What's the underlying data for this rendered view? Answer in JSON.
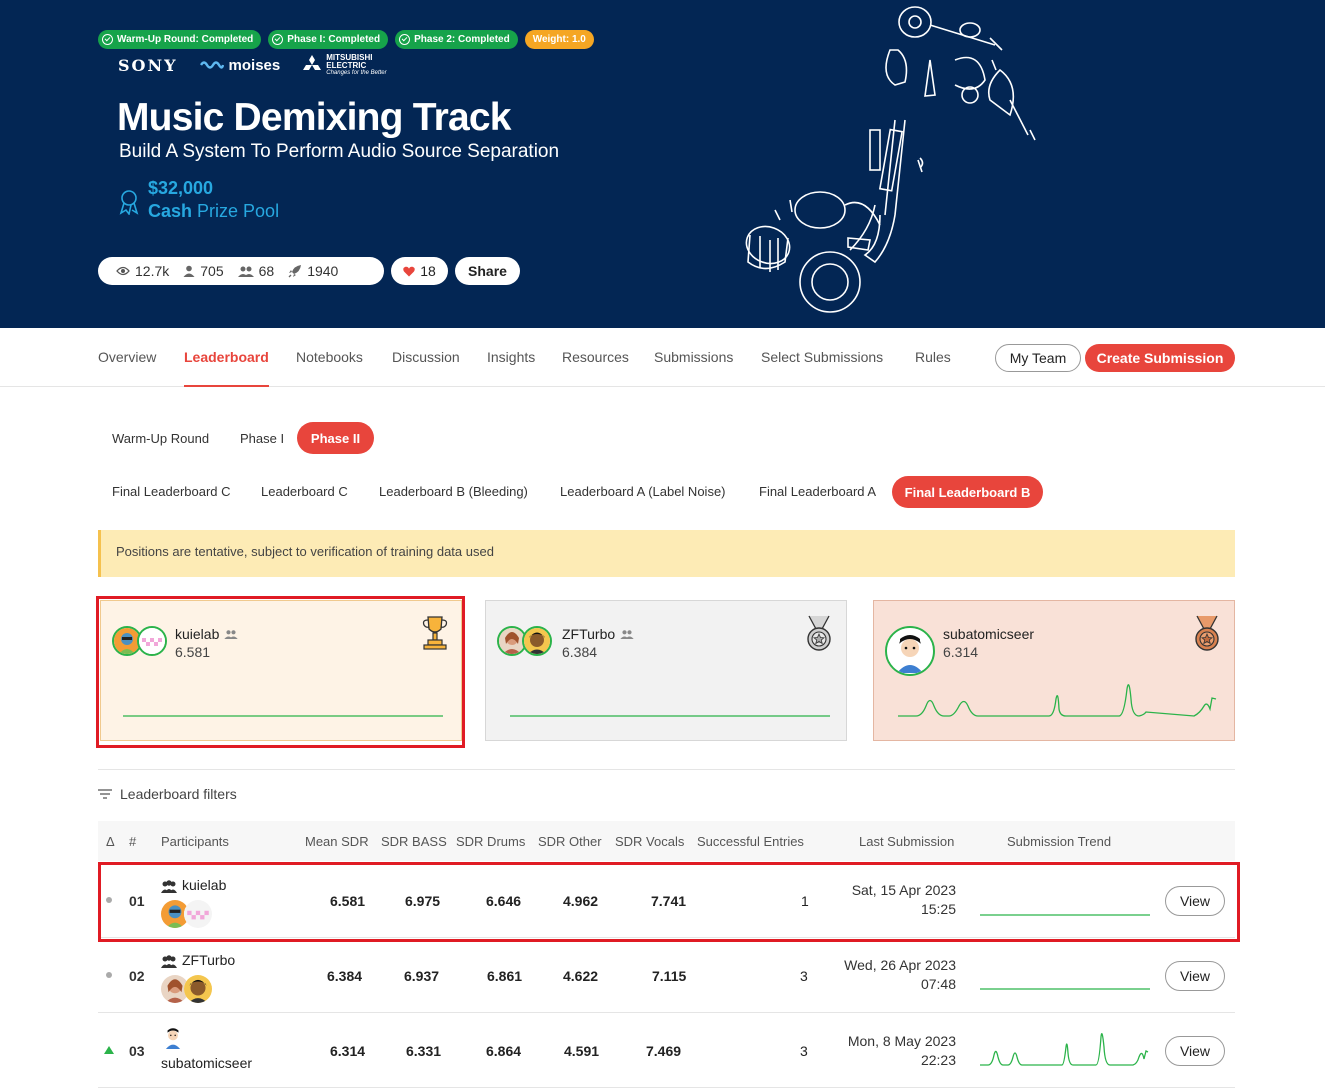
{
  "hero": {
    "badges": [
      {
        "label": "Warm-Up Round: Completed",
        "color": "#16a34a"
      },
      {
        "label": "Phase I: Completed",
        "color": "#16a34a"
      },
      {
        "label": "Phase 2: Completed",
        "color": "#16a34a"
      },
      {
        "label": "Weight: 1.0",
        "color": "#f5a623"
      }
    ],
    "sponsors": {
      "sony": "SONY",
      "moises": "moises",
      "mitsubishi_line1": "MITSUBISHI",
      "mitsubishi_line2": "ELECTRIC",
      "mitsubishi_tagline": "Changes for the Better"
    },
    "title": "Music Demixing Track",
    "subtitle": "Build A System To Perform Audio Source Separation",
    "prize_amount": "$32,000",
    "prize_label_bold": "Cash",
    "prize_label_rest": "Prize Pool",
    "stats": {
      "views": "12.7k",
      "participants": "705",
      "teams": "68",
      "submissions": "1940"
    },
    "likes": "18",
    "share_label": "Share"
  },
  "nav": {
    "items": [
      "Overview",
      "Leaderboard",
      "Notebooks",
      "Discussion",
      "Insights",
      "Resources",
      "Submissions",
      "Select Submissions",
      "Rules"
    ],
    "active": "Leaderboard",
    "my_team": "My Team",
    "create_submission": "Create Submission"
  },
  "rounds": [
    "Warm-Up Round",
    "Phase I",
    "Phase II"
  ],
  "active_round": "Phase II",
  "boards": [
    "Final Leaderboard C",
    "Leaderboard C",
    "Leaderboard B (Bleeding)",
    "Leaderboard A (Label Noise)",
    "Final Leaderboard A",
    "Final Leaderboard B"
  ],
  "active_board": "Final Leaderboard B",
  "notice": "Positions are tentative, subject to verification of training data used",
  "podium": [
    {
      "name": "kuielab",
      "score": "6.581",
      "medal": "trophy-icon"
    },
    {
      "name": "ZFTurbo",
      "score": "6.384",
      "medal": "silver-medal-icon"
    },
    {
      "name": "subatomicseer",
      "score": "6.314",
      "medal": "bronze-medal-icon"
    }
  ],
  "filters_label": "Leaderboard filters",
  "table": {
    "headers": [
      "Δ",
      "#",
      "Participants",
      "Mean SDR",
      "SDR BASS",
      "SDR Drums",
      "SDR Other",
      "SDR Vocals",
      "Successful Entries",
      "Last Submission",
      "Submission Trend"
    ],
    "rows": [
      {
        "delta": "dot",
        "rank": "01",
        "name": "kuielab",
        "mean": "6.581",
        "bass": "6.975",
        "drums": "6.646",
        "other": "4.962",
        "vocals": "7.741",
        "entries": "1",
        "date": "Sat, 15 Apr 2023",
        "time": "15:25",
        "view": "View"
      },
      {
        "delta": "dot",
        "rank": "02",
        "name": "ZFTurbo",
        "mean": "6.384",
        "bass": "6.937",
        "drums": "6.861",
        "other": "4.622",
        "vocals": "7.115",
        "entries": "3",
        "date": "Wed, 26 Apr 2023",
        "time": "07:48",
        "view": "View"
      },
      {
        "delta": "up",
        "rank": "03",
        "name": "subatomicseer",
        "mean": "6.314",
        "bass": "6.331",
        "drums": "6.864",
        "other": "4.591",
        "vocals": "7.469",
        "entries": "3",
        "date": "Mon, 8 May 2023",
        "time": "22:23",
        "view": "View"
      }
    ]
  },
  "colors": {
    "hero_bg": "#032654",
    "accent": "#e8453c",
    "prize": "#27a8e0",
    "trend": "#2bb34a"
  }
}
